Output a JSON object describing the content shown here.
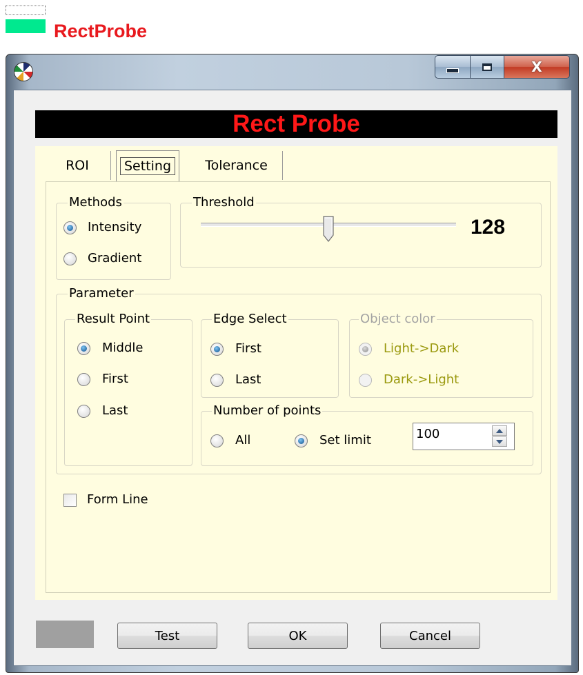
{
  "doc_title": "RectProbe",
  "window": {
    "icon": "app-color-wheel-icon",
    "controls": {
      "minimize": "minimize-icon",
      "maximize": "maximize-icon",
      "close": "X"
    }
  },
  "banner": {
    "title": "Rect Probe"
  },
  "tabs": [
    {
      "label": "ROI",
      "selected": false
    },
    {
      "label": "Setting",
      "selected": true
    },
    {
      "label": "Tolerance",
      "selected": false
    }
  ],
  "methods": {
    "label": "Methods",
    "options": [
      {
        "label": "Intensity",
        "selected": true
      },
      {
        "label": "Gradient",
        "selected": false
      }
    ]
  },
  "threshold": {
    "label": "Threshold",
    "value": "128",
    "level": 128,
    "min": 0,
    "max": 255
  },
  "parameter": {
    "label": "Parameter",
    "result_point": {
      "label": "Result Point",
      "options": [
        {
          "label": "Middle",
          "selected": true
        },
        {
          "label": "First",
          "selected": false
        },
        {
          "label": "Last",
          "selected": false
        }
      ]
    },
    "edge_select": {
      "label": "Edge Select",
      "options": [
        {
          "label": "First",
          "selected": true
        },
        {
          "label": "Last",
          "selected": false
        }
      ]
    },
    "object_color": {
      "label": "Object color",
      "enabled": false,
      "options": [
        {
          "label": "Light->Dark",
          "selected": true
        },
        {
          "label": "Dark->Light",
          "selected": false
        }
      ]
    },
    "number_of_points": {
      "label": "Number of points",
      "options": [
        {
          "label": "All",
          "selected": false
        },
        {
          "label": "Set limit",
          "selected": true
        }
      ],
      "limit_value": "100"
    }
  },
  "form_line": {
    "label": "Form Line",
    "checked": false
  },
  "buttons": {
    "test": "Test",
    "ok": "OK",
    "cancel": "Cancel"
  },
  "colors": {
    "banner_text": "#ff1818",
    "panel_bg": "#fffde0",
    "doc_title": "#e8191e",
    "accent_bar": "#00e98f"
  }
}
